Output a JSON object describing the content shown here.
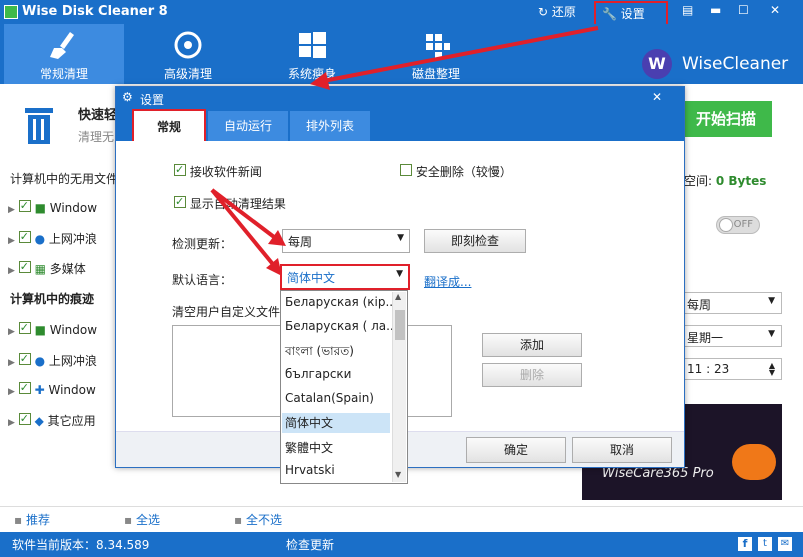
{
  "app": {
    "title": "Wise Disk Cleaner 8",
    "restore": "还原",
    "settings": "设置"
  },
  "toolbar": {
    "items": [
      "常规清理",
      "高级清理",
      "系统瘦身",
      "磁盘整理"
    ],
    "brand": "WiseCleaner"
  },
  "main": {
    "quick_title": "快速轻",
    "quick_sub": "清理无",
    "scan_button": "开始扫描",
    "space_label": "空间:",
    "space_value": "0 Bytes",
    "toggle": "OFF",
    "section1": "计算机中的无用文件",
    "section1_items": [
      "Window",
      "上网冲浪",
      "多媒体"
    ],
    "section2": "计算机中的痕迹",
    "section2_items": [
      "Window",
      "上网冲浪",
      "Window",
      "其它应用"
    ],
    "schedule_freq": "每周",
    "schedule_day": "星期一",
    "schedule_time": "11 : 23",
    "promo_text": "WiseCare365 Pro"
  },
  "footer": {
    "recommend": "推荐",
    "select_all": "全选",
    "select_none": "全不选"
  },
  "status": {
    "version": "软件当前版本：8.34.589",
    "check_update": "检查更新"
  },
  "dialog": {
    "title": "设置",
    "tabs": [
      "常规",
      "自动运行",
      "排外列表"
    ],
    "receive_news": "接收软件新闻",
    "safe_delete": "安全删除（较慢）",
    "show_results": "显示自动清理结果",
    "check_update_label": "检测更新：",
    "check_update_value": "每周",
    "check_now": "即刻检查",
    "lang_label": "默认语言：",
    "lang_value": "简体中文",
    "translate": "翻译成...",
    "custom_files": "清空用户自定义文件",
    "add": "添加",
    "delete": "删除",
    "ok": "确定",
    "cancel": "取消",
    "languages": [
      "Беларуская (кір...",
      "Беларуская ( ла...",
      "বাংলা (ভারত)",
      "български",
      "Catalan(Spain)",
      "简体中文",
      "繁體中文",
      "Hrvatski"
    ]
  },
  "colors": {
    "accent": "#1a6fc9",
    "scan": "#3fb94a",
    "highlight": "#e0202a"
  }
}
